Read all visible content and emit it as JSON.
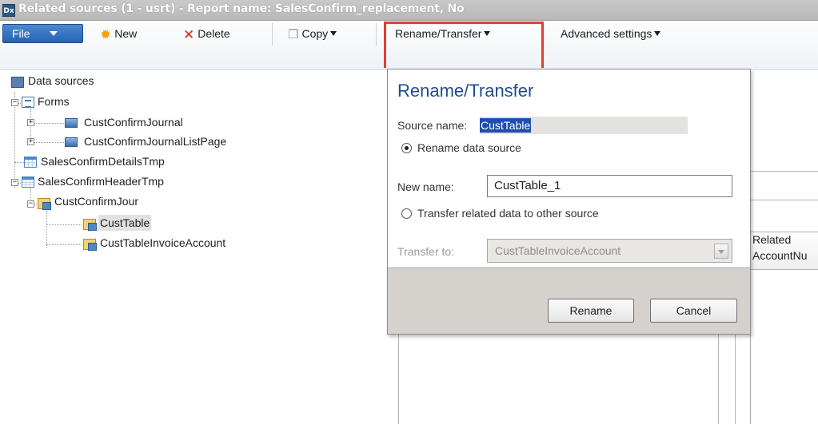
{
  "window": {
    "title": "Related sources (1 - usrt) - Report name: SalesConfirm_replacement, No",
    "app_icon_text": "Dx"
  },
  "toolbar": {
    "file_label": "File",
    "new_label": "New",
    "delete_label": "Delete",
    "copy_label": "Copy",
    "rename_transfer_label": "Rename/Transfer",
    "advanced_settings_label": "Advanced settings"
  },
  "tree": {
    "root": "Data sources",
    "forms": "Forms",
    "form_items": [
      "CustConfirmJournal",
      "CustConfirmJournalListPage"
    ],
    "details_tmp": "SalesConfirmDetailsTmp",
    "header_tmp": "SalesConfirmHeaderTmp",
    "cust_confirm_jour": "CustConfirmJour",
    "cust_table": "CustTable",
    "cust_table_invoice_account": "CustTableInvoiceAccount"
  },
  "background_grid": {
    "header_line1": "Related",
    "header_line2": "AccountNu"
  },
  "popup": {
    "title": "Rename/Transfer",
    "source_name_label": "Source name:",
    "source_name_value": "CustTable",
    "rename_option": "Rename data source",
    "rename_selected": true,
    "new_name_label": "New name:",
    "new_name_value": "CustTable_1",
    "transfer_option": "Transfer related data to other source",
    "transfer_to_label": "Transfer to:",
    "transfer_to_value": "CustTableInvoiceAccount",
    "rename_button": "Rename",
    "cancel_button": "Cancel"
  },
  "colors": {
    "highlight_box": "#e23c37",
    "file_button": "#2564b3",
    "popup_title": "#1f4d8f",
    "selection": "#1f4fae"
  }
}
